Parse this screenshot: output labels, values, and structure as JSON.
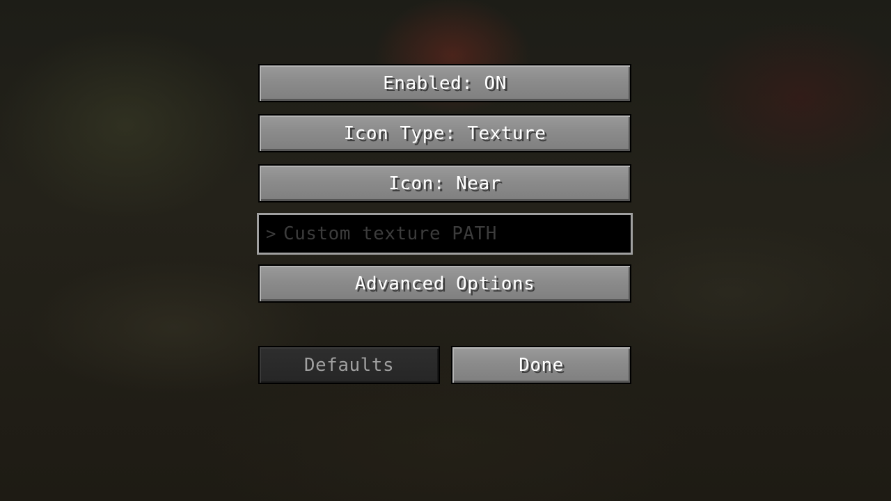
{
  "options": {
    "enabled_label": "Enabled: ON",
    "icon_type_label": "Icon Type: Texture",
    "icon_label": "Icon: Near",
    "texture_path_placeholder": "Custom texture PATH",
    "texture_path_prompt": ">",
    "advanced_label": "Advanced Options"
  },
  "footer": {
    "defaults_label": "Defaults",
    "done_label": "Done"
  },
  "colors": {
    "button_face": "#8b8b8b",
    "button_text": "#ffffff",
    "disabled_text": "#a0a0a0",
    "textfield_border": "#a0a0a0",
    "textfield_placeholder": "#3c3c3c"
  }
}
